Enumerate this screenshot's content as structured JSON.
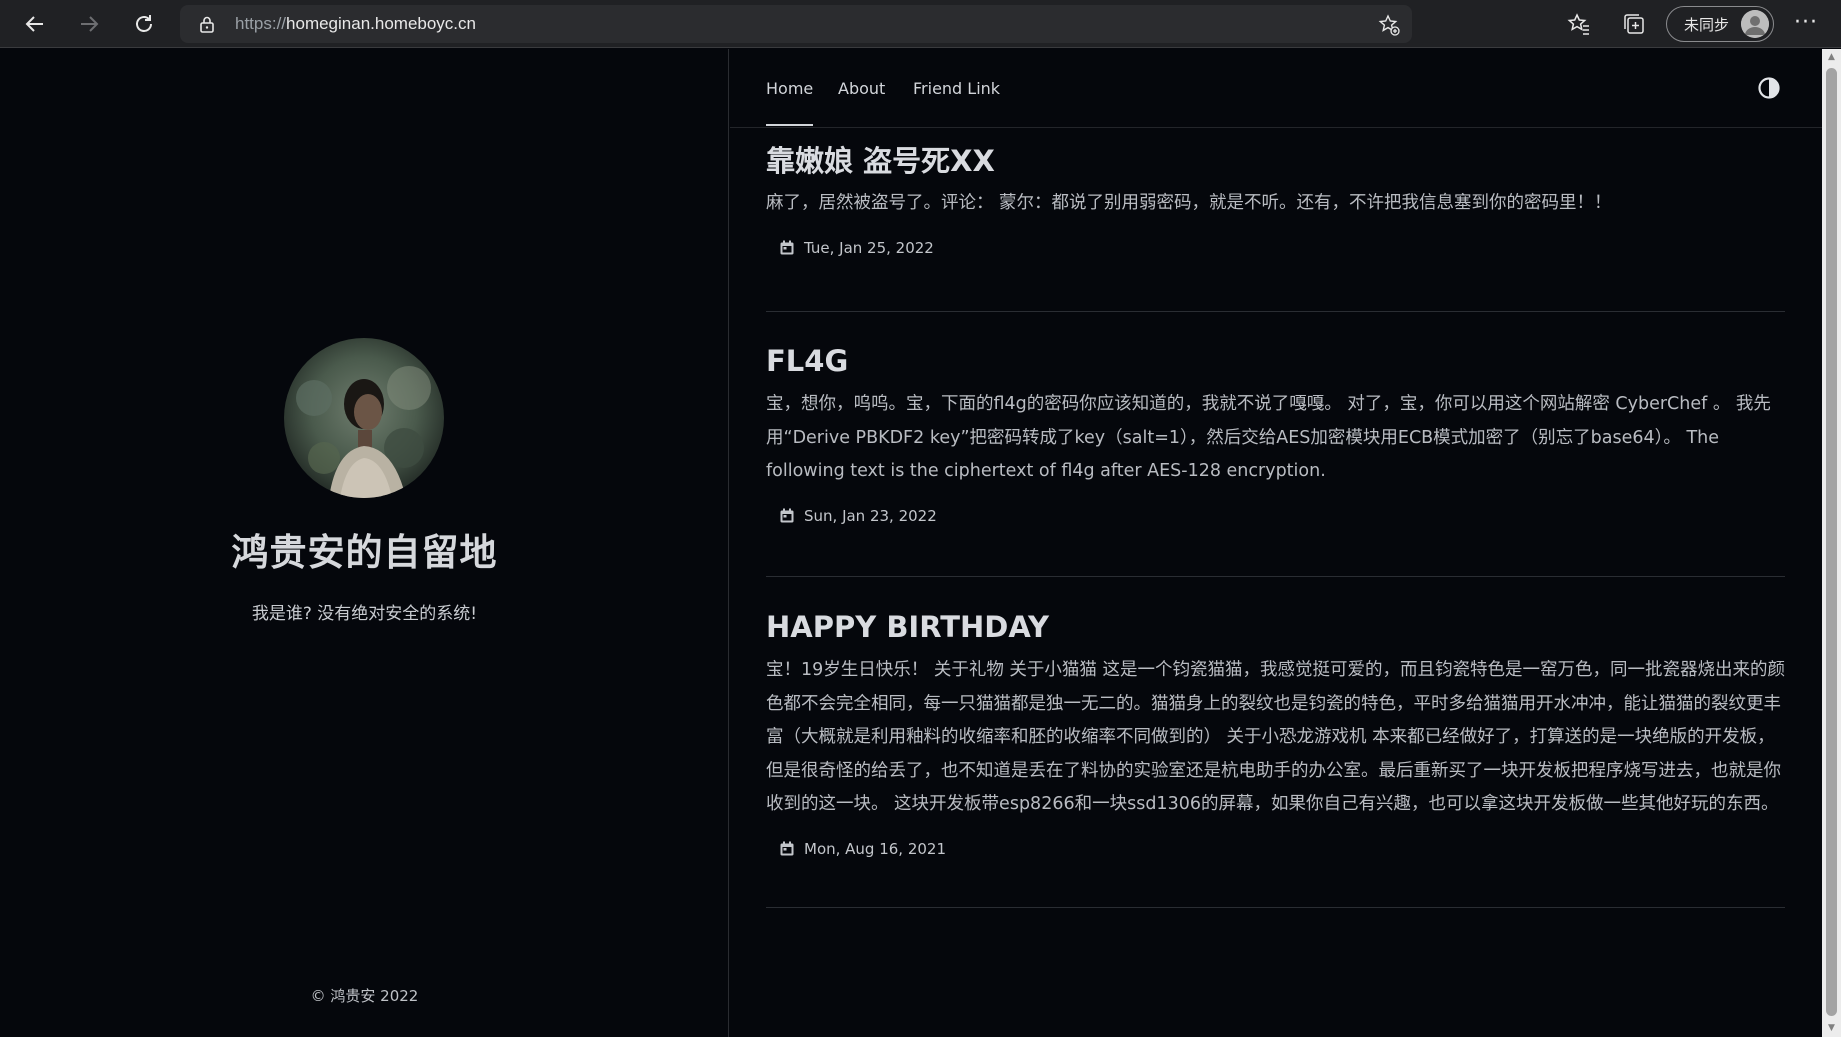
{
  "browser": {
    "url_scheme": "https://",
    "url_host": "homeginan.homeboyc.cn",
    "profile_label": "未同步",
    "more_label": "···"
  },
  "sidebar": {
    "site_title": "鸿贵安的自留地",
    "subtitle": "我是谁? 没有绝对安全的系统!",
    "copyright": "© 鸿贵安 2022"
  },
  "nav": {
    "items": [
      {
        "label": "Home",
        "active": true
      },
      {
        "label": "About",
        "active": false
      },
      {
        "label": "Friend Link",
        "active": false
      }
    ]
  },
  "posts": [
    {
      "title": "靠嫩娘 盗号死XX",
      "excerpt": "麻了，居然被盗号了。评论： 蒙尔：都说了别用弱密码，就是不听。还有，不许把我信息塞到你的密码里！！",
      "date": "Tue, Jan 25, 2022"
    },
    {
      "title": "FL4G",
      "excerpt": "宝，想你，呜呜。宝，下面的fl4g的密码你应该知道的，我就不说了嘎嘎。 对了，宝，你可以用这个网站解密 CyberChef 。 我先用“Derive PBKDF2 key”把密码转成了key（salt=1），然后交给AES加密模块用ECB模式加密了（别忘了base64）。 The following text is the ciphertext of fl4g after AES-128 encryption.",
      "date": "Sun, Jan 23, 2022"
    },
    {
      "title": "HAPPY BIRTHDAY",
      "excerpt": "宝！19岁生日快乐！ 关于礼物 关于小猫猫 这是一个钧瓷猫猫，我感觉挺可爱的，而且钧瓷特色是一窑万色，同一批瓷器烧出来的颜色都不会完全相同，每一只猫猫都是独一无二的。猫猫身上的裂纹也是钧瓷的特色，平时多给猫猫用开水冲冲，能让猫猫的裂纹更丰富（大概就是利用釉料的收缩率和胚的收缩率不同做到的） 关于小恐龙游戏机 本来都已经做好了，打算送的是一块绝版的开发板，但是很奇怪的给丢了，也不知道是丢在了料协的实验室还是杭电助手的办公室。最后重新买了一块开发板把程序烧写进去，也就是你收到的这一块。 这块开发板带esp8266和一块ssd1306的屏幕，如果你自己有兴趣，也可以拿这块开发板做一些其他好玩的东西。",
      "date": "Mon, Aug 16, 2021"
    }
  ]
}
